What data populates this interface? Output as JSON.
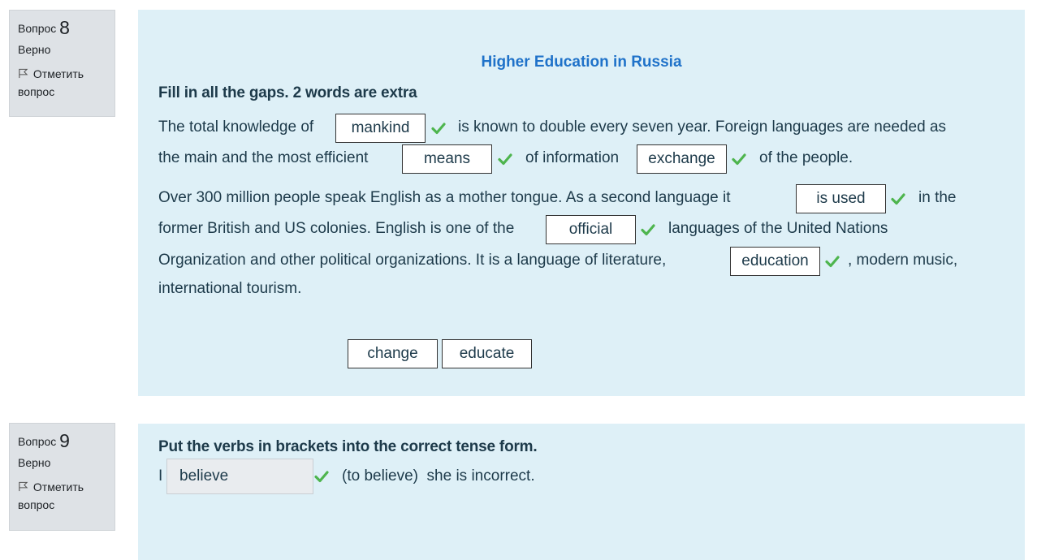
{
  "q8": {
    "label": "Вопрос",
    "number": "8",
    "state": "Верно",
    "flag_line1": "Отметить",
    "flag_line2": "вопрос",
    "title": "Higher Education in Russia",
    "instruction": "Fill in all the gaps. 2 words are extra",
    "p1": {
      "t1": "The total knowledge of",
      "t2": "is known to double every seven year. Foreign languages are needed as",
      "t3": "the main and the most efficient",
      "t4": "of information",
      "t5": "of the people."
    },
    "p2": {
      "t1": "Over 300 million people speak English as a mother tongue. As a second language it",
      "t2": "in the",
      "t3": "former British and US colonies. English is one of the",
      "t4": "languages of the United Nations",
      "t5": "Organization and other political organizations. It is a language of literature,",
      "t6": ", modern music,",
      "t7": "international tourism."
    },
    "gaps": [
      "mankind",
      "means",
      "exchange",
      "is used",
      "official",
      "education"
    ],
    "drag_items": [
      "change",
      "educate"
    ]
  },
  "q9": {
    "label": "Вопрос",
    "number": "9",
    "state": "Верно",
    "flag_line1": "Отметить",
    "flag_line2": "вопрос",
    "instruction": "Put the verbs in brackets into the correct tense form.",
    "prefix": "I",
    "answer": "believe",
    "suffix": "(to believe)  she is incorrect."
  },
  "colors": {
    "content_bg": "#def0f7",
    "info_bg": "#dee2e6",
    "title": "#1f72c9",
    "correct": "#4eb54e"
  },
  "icons": {
    "flag": "flag-icon",
    "check": "check-icon"
  }
}
